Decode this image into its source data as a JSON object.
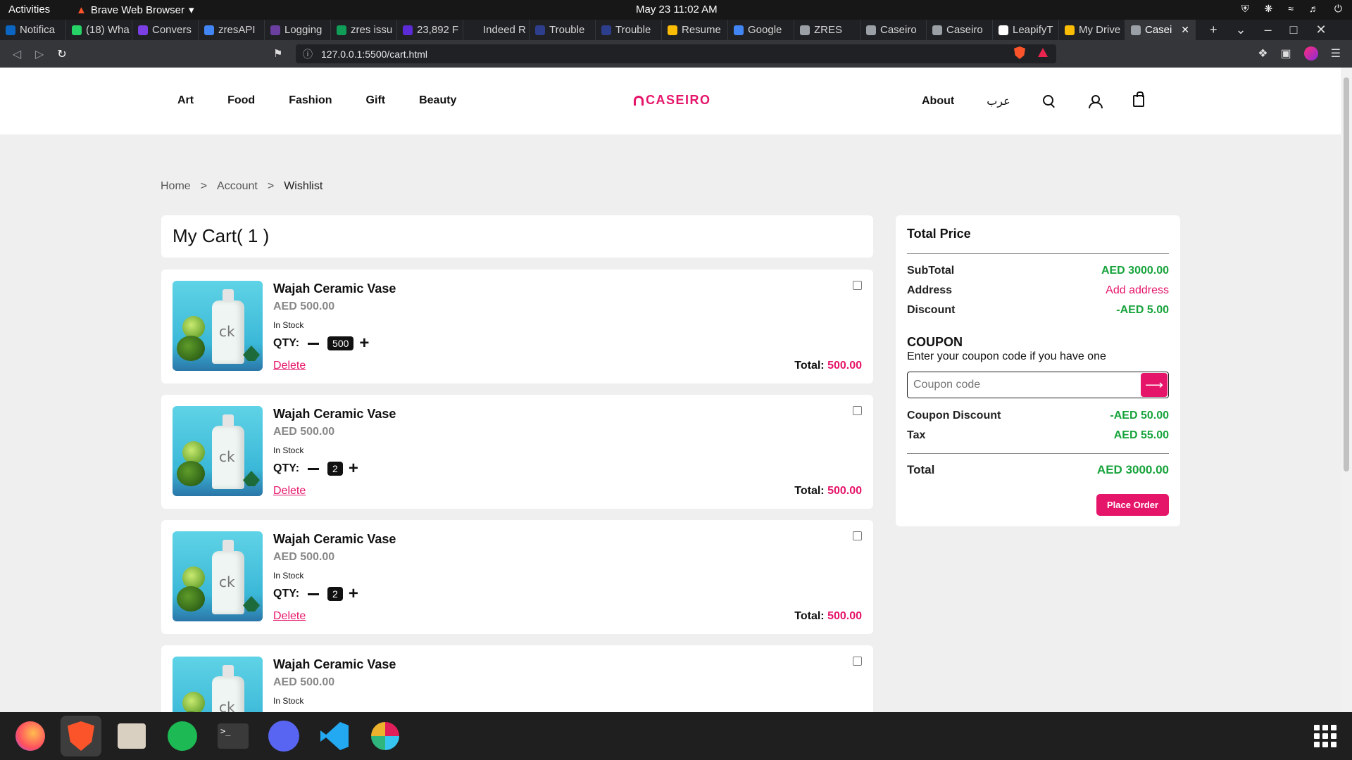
{
  "system": {
    "activities": "Activities",
    "app_name": "Brave Web Browser",
    "clock": "May 23  11:02 AM"
  },
  "tabs": [
    {
      "label": "Notifica",
      "color": "#0a66c2"
    },
    {
      "label": "(18) Wha",
      "color": "#25d366"
    },
    {
      "label": "Convers",
      "color": "#7b3fe4"
    },
    {
      "label": "zresAPI",
      "color": "#4285f4"
    },
    {
      "label": "Logging",
      "color": "#6b3fa0"
    },
    {
      "label": "zres issu",
      "color": "#0f9d58"
    },
    {
      "label": "23,892 F",
      "color": "#5c2bd8"
    },
    {
      "label": "Indeed R",
      "color": "#202124"
    },
    {
      "label": "Trouble",
      "color": "#2c3e8c"
    },
    {
      "label": "Trouble",
      "color": "#2c3e8c"
    },
    {
      "label": "Resume",
      "color": "#fbbc04"
    },
    {
      "label": "Google",
      "color": "#4285f4"
    },
    {
      "label": "ZRES",
      "color": "#9aa0a6"
    },
    {
      "label": "Caseiro",
      "color": "#9aa0a6"
    },
    {
      "label": "Caseiro",
      "color": "#9aa0a6"
    },
    {
      "label": "LeapifyT",
      "color": "#ffffff"
    },
    {
      "label": "My Drive",
      "color": "#fbbc04"
    },
    {
      "label": "Casei",
      "color": "#9aa0a6",
      "active": true
    }
  ],
  "address": {
    "url": "127.0.0.1:5500/cart.html"
  },
  "site": {
    "nav_left": [
      "Art",
      "Food",
      "Fashion",
      "Gift",
      "Beauty"
    ],
    "logo": "CASEIRO",
    "about": "About",
    "lang": "عرب"
  },
  "breadcrumb": {
    "home": "Home",
    "sep": ">",
    "account": "Account",
    "current": "Wishlist"
  },
  "cart": {
    "title": "My Cart( 1 )",
    "stock_label": "In Stock",
    "qty_label": "QTY:",
    "delete_label": "Delete",
    "total_label": "Total:",
    "items": [
      {
        "name": "Wajah Ceramic Vase",
        "price": "AED 500.00",
        "qty": "500",
        "total": "500.00"
      },
      {
        "name": "Wajah Ceramic Vase",
        "price": "AED 500.00",
        "qty": "2",
        "total": "500.00"
      },
      {
        "name": "Wajah Ceramic Vase",
        "price": "AED 500.00",
        "qty": "2",
        "total": "500.00"
      },
      {
        "name": "Wajah Ceramic Vase",
        "price": "AED 500.00",
        "qty": "",
        "total": ""
      }
    ]
  },
  "summary": {
    "title": "Total Price",
    "subtotal_label": "SubTotal",
    "subtotal": "AED 3000.00",
    "address_label": "Address",
    "address_link": "Add address",
    "discount_label": "Discount",
    "discount": "-AED 5.00",
    "coupon_title": "COUPON",
    "coupon_sub": "Enter your coupon code if you have one",
    "coupon_placeholder": "Coupon code",
    "coupon_discount_label": "Coupon Discount",
    "coupon_discount": "-AED 50.00",
    "tax_label": "Tax",
    "tax": "AED 55.00",
    "total_label": "Total",
    "total": "AED 3000.00",
    "place_order": "Place Order"
  },
  "colors": {
    "brand": "#e5156a",
    "positive": "#17a33c"
  }
}
